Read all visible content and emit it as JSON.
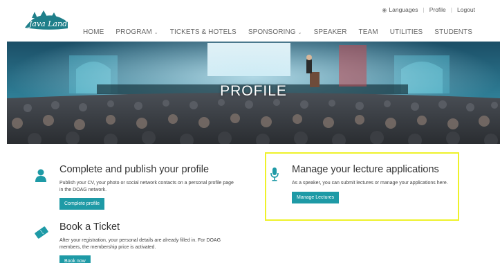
{
  "brand": {
    "logo_text": "Java Land",
    "accent": "#1e9aa6",
    "highlight": "#eef22a"
  },
  "top_links": {
    "languages": "Languages",
    "profile": "Profile",
    "logout": "Logout"
  },
  "nav": {
    "items": [
      {
        "label": "HOME",
        "dropdown": false
      },
      {
        "label": "PROGRAM",
        "dropdown": true
      },
      {
        "label": "TICKETS & HOTELS",
        "dropdown": false
      },
      {
        "label": "SPONSORING",
        "dropdown": true
      },
      {
        "label": "SPEAKER",
        "dropdown": false
      },
      {
        "label": "TEAM",
        "dropdown": false
      },
      {
        "label": "UTILITIES",
        "dropdown": false
      },
      {
        "label": "STUDENTS",
        "dropdown": false
      }
    ]
  },
  "hero": {
    "title": "PROFILE"
  },
  "cards": {
    "profile": {
      "icon": "user-icon",
      "title": "Complete and publish your profile",
      "text": "Publish your CV, your photo or social network contacts on a personal profile page in the DOAG network.",
      "button": "Complete profile"
    },
    "lectures": {
      "icon": "microphone-icon",
      "title": "Manage your lecture applications",
      "text": "As a speaker, you can submit lectures or manage your applications here.",
      "button": "Manage Lectures"
    },
    "ticket": {
      "icon": "ticket-icon",
      "title": "Book a Ticket",
      "text": "After your registration, your personal details are already filled in. For DOAG members, the membership price is activated.",
      "button": "Book now"
    }
  }
}
